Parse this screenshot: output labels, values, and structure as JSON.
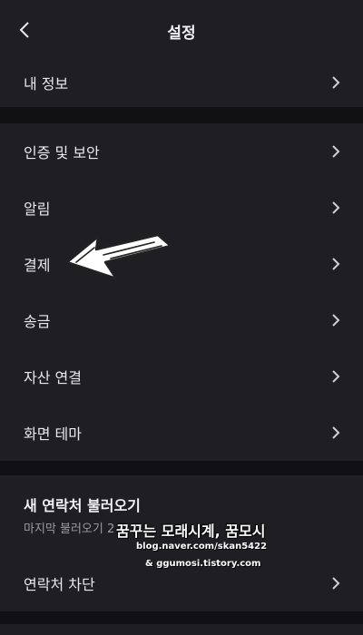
{
  "header": {
    "title": "설정",
    "back_icon": "chevron-left-icon"
  },
  "sections": {
    "account": {
      "my_info": "내 정보"
    },
    "settings": {
      "auth_security": "인증 및 보안",
      "notifications": "알림",
      "payment": "결제",
      "transfer": "송금",
      "asset_link": "자산 연결",
      "screen_theme": "화면 테마"
    },
    "contacts": {
      "import_title": "새 연락처 불러오기",
      "import_subtitle": "마지막 불러오기 2",
      "block": "연락처 차단"
    }
  },
  "annotation": {
    "arrow_icon": "hand-drawn-arrow-left",
    "color": "#ffffff"
  },
  "watermark": {
    "line1": "꿈꾸는 모래시계, 꿈모시",
    "line2": "blog.naver.com/skan5422",
    "line3": "& ggumosi.tistory.com"
  },
  "colors": {
    "background": "#111113",
    "surface": "#1f1f23",
    "text": "#e9e9ec",
    "subtext": "#9a9aa2"
  }
}
